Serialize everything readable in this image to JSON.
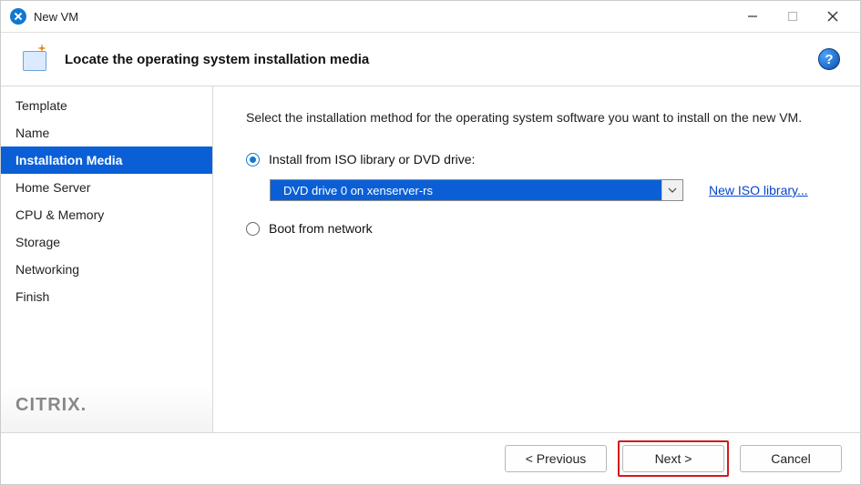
{
  "window": {
    "title": "New VM"
  },
  "header": {
    "title": "Locate the operating system installation media"
  },
  "sidebar": {
    "items": [
      {
        "label": "Template",
        "active": false
      },
      {
        "label": "Name",
        "active": false
      },
      {
        "label": "Installation Media",
        "active": true
      },
      {
        "label": "Home Server",
        "active": false
      },
      {
        "label": "CPU & Memory",
        "active": false
      },
      {
        "label": "Storage",
        "active": false
      },
      {
        "label": "Networking",
        "active": false
      },
      {
        "label": "Finish",
        "active": false
      }
    ],
    "brand": "CITRIX"
  },
  "content": {
    "instruction": "Select the installation method for the operating system software you want to install on the new VM.",
    "option_install_label": "Install from ISO library or DVD drive:",
    "option_boot_label": "Boot from network",
    "selected_option": "install",
    "dropdown_value": "DVD drive 0 on xenserver-rs",
    "new_iso_link": "New ISO library..."
  },
  "footer": {
    "previous": "< Previous",
    "next": "Next >",
    "cancel": "Cancel"
  }
}
